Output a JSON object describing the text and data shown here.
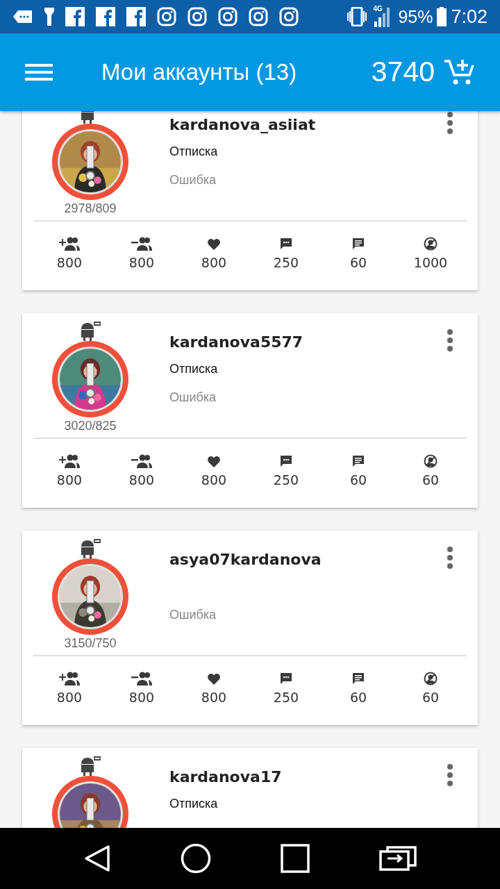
{
  "status_bar": {
    "notifications": [
      {
        "kind": "tag"
      },
      {
        "kind": "flashlight"
      },
      {
        "kind": "facebook"
      },
      {
        "kind": "facebook"
      },
      {
        "kind": "facebook"
      },
      {
        "kind": "instagram"
      },
      {
        "kind": "instagram"
      },
      {
        "kind": "instagram"
      },
      {
        "kind": "instagram"
      },
      {
        "kind": "instagram"
      }
    ],
    "network": "4G",
    "battery": "95%",
    "time": "7:02"
  },
  "app_bar": {
    "title": "Мои аккаунты (13)",
    "balance": "3740"
  },
  "accounts": [
    {
      "username": "kardanova_asiiat",
      "status": "Отписка",
      "error": "Ошибка",
      "counts": "2978/809",
      "stats": [
        {
          "kind": "follow",
          "value": "800"
        },
        {
          "kind": "unfollow",
          "value": "800"
        },
        {
          "kind": "like",
          "value": "800"
        },
        {
          "kind": "comment",
          "value": "250"
        },
        {
          "kind": "message",
          "value": "60"
        },
        {
          "kind": "profile",
          "value": "1000"
        }
      ]
    },
    {
      "username": "kardanova5577",
      "status": "Отписка",
      "error": "Ошибка",
      "counts": "3020/825",
      "stats": [
        {
          "kind": "follow",
          "value": "800"
        },
        {
          "kind": "unfollow",
          "value": "800"
        },
        {
          "kind": "like",
          "value": "800"
        },
        {
          "kind": "comment",
          "value": "250"
        },
        {
          "kind": "message",
          "value": "60"
        },
        {
          "kind": "profile",
          "value": "60"
        }
      ]
    },
    {
      "username": "asya07kardanova",
      "error": "Ошибка",
      "counts": "3150/750",
      "stats": [
        {
          "kind": "follow",
          "value": "800"
        },
        {
          "kind": "unfollow",
          "value": "800"
        },
        {
          "kind": "like",
          "value": "800"
        },
        {
          "kind": "comment",
          "value": "250"
        },
        {
          "kind": "message",
          "value": "60"
        },
        {
          "kind": "profile",
          "value": "60"
        }
      ]
    },
    {
      "username": "kardanova17",
      "status": "Отписка"
    }
  ]
}
